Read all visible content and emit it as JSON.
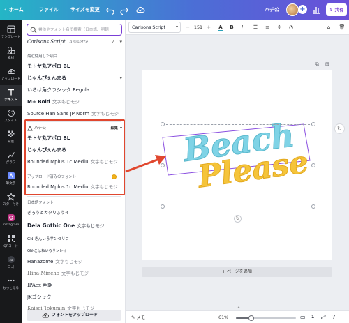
{
  "topbar": {
    "home_label": "ホーム",
    "file_label": "ファイル",
    "resize_label": "サイズを変更",
    "team_name": "ハチ公",
    "share_label": "共有",
    "icons": [
      "chevron-left-icon",
      "undo-icon",
      "redo-icon",
      "cloud-saved-icon",
      "plus-icon",
      "chart-icon",
      "share-icon"
    ]
  },
  "rail": {
    "items": [
      {
        "label": "テンプレート",
        "icon": "template-icon"
      },
      {
        "label": "素材",
        "icon": "elements-icon"
      },
      {
        "label": "アップロード",
        "icon": "upload-icon"
      },
      {
        "label": "テキスト",
        "icon": "text-icon"
      },
      {
        "label": "スタイル",
        "icon": "style-icon"
      },
      {
        "label": "背景",
        "icon": "background-icon"
      },
      {
        "label": "グラフ",
        "icon": "chart-icon"
      },
      {
        "label": "筆文字",
        "icon": "brush-icon"
      },
      {
        "label": "スター付き",
        "icon": "star-icon"
      },
      {
        "label": "Instagram",
        "icon": "instagram-icon"
      },
      {
        "label": "QRコード",
        "icon": "qr-icon"
      },
      {
        "label": "ロゴ",
        "icon": "logo-icon"
      },
      {
        "label": "もっと見る",
        "icon": "more-icon"
      }
    ]
  },
  "panel": {
    "search_placeholder": "書体やフォント名で検索（日本語、明朝",
    "current_fonts": [
      "Carlsons Script",
      "Anisette"
    ],
    "recent_header": "最近使用した項目",
    "recent_fonts": [
      {
        "name": "モトヤ丸アポロ BL",
        "sample": ""
      },
      {
        "name": "じゃんぴぇんまる",
        "sample": ""
      },
      {
        "name": "いろは角クラシック Regula",
        "sample": ""
      },
      {
        "name": "M+ Bold",
        "sample": "文字もじモジ"
      },
      {
        "name": "Source Han Sans JP Norm",
        "sample": "文字もじモジ"
      }
    ],
    "brand": {
      "name": "ハチ公",
      "edit_label": "編集",
      "more": "▾"
    },
    "brand_fonts": [
      {
        "name": "モトヤ丸アポロ BL",
        "sample": ""
      },
      {
        "name": "じゃんぴぇんまる",
        "sample": ""
      },
      {
        "name": "Rounded Mplus 1c Mediu",
        "sample": "文字もじモジ"
      }
    ],
    "uploaded_header": "アップロード済みのフォント",
    "uploaded_fonts": [
      {
        "name": "Rounded Mplus 1c Mediu",
        "sample": "文字もじモジ"
      }
    ],
    "japanese_header": "日本語フォント",
    "japanese_fonts": [
      {
        "name": "ぎろうとカタりょうイ",
        "sample": ""
      },
      {
        "name": "Dela Gothic One",
        "sample": "文字もじモジ"
      },
      {
        "name": "GN-きんいろサンセリフ",
        "sample": ""
      },
      {
        "name": "GN-こはねいろサンレイ",
        "sample": ""
      },
      {
        "name": "Hanazome",
        "sample": "文字もじモジ"
      },
      {
        "name": "Hina-Mincho",
        "sample": "文字もじモジ"
      },
      {
        "name": "IPAex 明朝",
        "sample": ""
      },
      {
        "name": "JKゴシック",
        "sample": ""
      },
      {
        "name": "Kaisei Tokumin",
        "sample": "文字もじモジ"
      }
    ],
    "upload_button": "フォントをアップロード"
  },
  "toolbar": {
    "font_name": "Carlsons Script",
    "font_size": "151",
    "minus": "−",
    "plus": "+"
  },
  "canvas": {
    "text_line1": "Beach",
    "text_line2": "Please",
    "add_page_label": "+ ページを追加",
    "colors": {
      "line1": "#7fd3e6",
      "line2": "#f5c43a",
      "highlight": "#e0472f",
      "annotation_box": "#8a4fe0"
    }
  },
  "bottombar": {
    "memo_label": "メモ",
    "zoom_label": "61%",
    "zoom_value": 0.61
  }
}
